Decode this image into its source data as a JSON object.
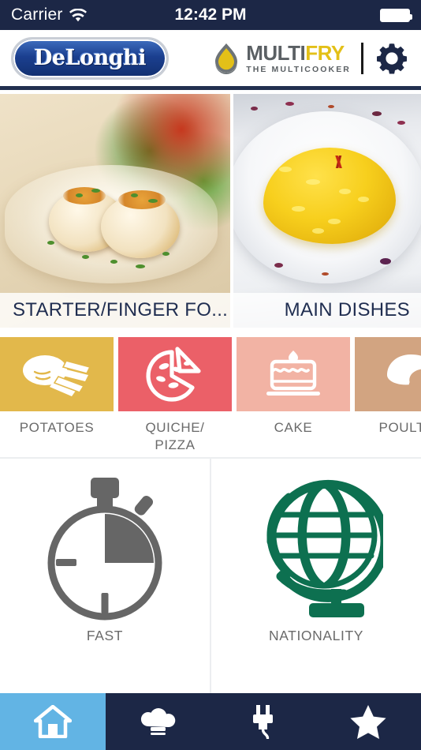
{
  "status_bar": {
    "carrier": "Carrier",
    "wifi_icon": "wifi-icon",
    "time": "12:42 PM",
    "battery_icon": "battery-full-icon"
  },
  "header": {
    "brand_logo_text": "DeLonghi",
    "product_logo": {
      "drop_icon": "oil-drop-icon",
      "word_multi": "MULTI",
      "word_fry": "FRY",
      "tagline": "THE MULTICOOKER"
    },
    "settings_icon": "gear-icon"
  },
  "carousel": {
    "cards": [
      {
        "label": "STARTER/FINGER FO...",
        "image": "scallops-photo"
      },
      {
        "label": "MAIN DISHES",
        "image": "saffron-risotto-photo"
      }
    ]
  },
  "categories": [
    {
      "label": "POTATOES",
      "icon": "potato-fries-icon",
      "color": "#e2b84b"
    },
    {
      "label": "QUICHE/\nPIZZA",
      "icon": "pizza-slice-icon",
      "color": "#eb6068"
    },
    {
      "label": "CAKE",
      "icon": "layer-cake-icon",
      "color": "#f2b3a4"
    },
    {
      "label": "POULTRY",
      "icon": "poultry-icon",
      "color": "#d2a481"
    }
  ],
  "features": [
    {
      "label": "FAST",
      "icon": "stopwatch-icon",
      "color": "#666666"
    },
    {
      "label": "NATIONALITY",
      "icon": "globe-icon",
      "color": "#0d7050"
    }
  ],
  "tab_bar": {
    "active_color": "#62b4e4",
    "background": "#1c2746",
    "tabs": [
      {
        "icon": "home-icon",
        "active": true
      },
      {
        "icon": "chef-hat-icon",
        "active": false
      },
      {
        "icon": "plug-icon",
        "active": false
      },
      {
        "icon": "star-icon",
        "active": false
      }
    ]
  }
}
